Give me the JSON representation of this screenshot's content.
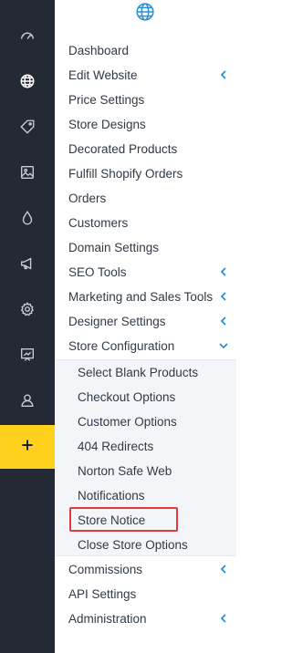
{
  "rail": {
    "items": [
      {
        "icon": "dashboard-gauge-icon"
      },
      {
        "icon": "globe-icon"
      },
      {
        "icon": "tag-icon"
      },
      {
        "icon": "image-icon"
      },
      {
        "icon": "drop-icon"
      },
      {
        "icon": "megaphone-icon"
      },
      {
        "icon": "gear-icon"
      },
      {
        "icon": "presentation-chart-icon"
      },
      {
        "icon": "user-icon"
      }
    ],
    "add_icon": "plus-icon",
    "add_color": "#ffd01c",
    "background": "#232a36"
  },
  "panel": {
    "header_icon": "globe-icon",
    "accent": "#2b8fd6",
    "items": [
      {
        "label": "Dashboard"
      },
      {
        "label": "Edit Website",
        "chevron": "left"
      },
      {
        "label": "Price Settings"
      },
      {
        "label": "Store Designs"
      },
      {
        "label": "Decorated Products"
      },
      {
        "label": "Fulfill Shopify Orders"
      },
      {
        "label": "Orders"
      },
      {
        "label": "Customers"
      },
      {
        "label": "Domain Settings"
      },
      {
        "label": "SEO Tools",
        "chevron": "left"
      },
      {
        "label": "Marketing and Sales Tools",
        "chevron": "left"
      },
      {
        "label": "Designer Settings",
        "chevron": "left"
      },
      {
        "label": "Store Configuration",
        "chevron": "down",
        "expanded": true
      }
    ],
    "store_configuration_subitems": [
      {
        "label": "Select Blank Products"
      },
      {
        "label": "Checkout Options"
      },
      {
        "label": "Customer Options"
      },
      {
        "label": "404 Redirects"
      },
      {
        "label": "Norton Safe Web"
      },
      {
        "label": "Notifications"
      },
      {
        "label": "Store Notice",
        "highlighted": true
      },
      {
        "label": "Close Store Options"
      }
    ],
    "after_items": [
      {
        "label": "Commissions",
        "chevron": "left"
      },
      {
        "label": "API Settings"
      },
      {
        "label": "Administration",
        "chevron": "left"
      }
    ],
    "highlight_color": "#e23b3f"
  }
}
